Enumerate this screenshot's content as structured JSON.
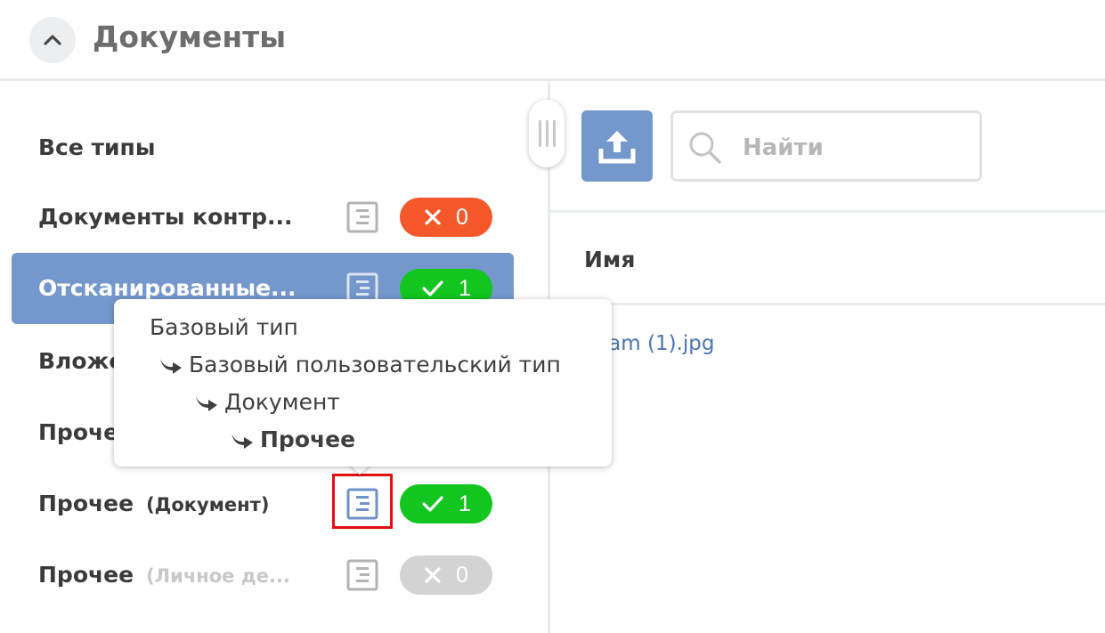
{
  "header": {
    "title": "Документы",
    "collapse_icon": "chevron-up-icon"
  },
  "types": [
    {
      "label": "Все типы",
      "sub": ""
    },
    {
      "label": "Документы контр...",
      "sub": "",
      "count": "0",
      "status": "error"
    },
    {
      "label": "Отсканированные...",
      "sub": "",
      "count": "1",
      "status": "ok",
      "selected": true
    },
    {
      "label": "Вложе",
      "sub": ""
    },
    {
      "label": "Прочее",
      "sub": ""
    },
    {
      "label": "Прочее",
      "sub": "(Документ)",
      "count": "1",
      "status": "ok"
    },
    {
      "label": "Прочее",
      "sub": "(Личное де...",
      "count": "0",
      "status": "empty"
    }
  ],
  "toolbar": {
    "upload_icon": "upload-icon",
    "search_placeholder": "Найти"
  },
  "table": {
    "column_name": "Имя",
    "file_name": "agram (1).jpg"
  },
  "tooltip": {
    "lines": [
      "Базовый тип",
      "Базовый пользовательский тип",
      "Документ",
      "Прочее"
    ]
  },
  "colors": {
    "accent": "#7497cc",
    "error": "#f4582a",
    "ok": "#13c51f",
    "empty": "#d3d3d3",
    "highlight": "#e40f0f"
  }
}
